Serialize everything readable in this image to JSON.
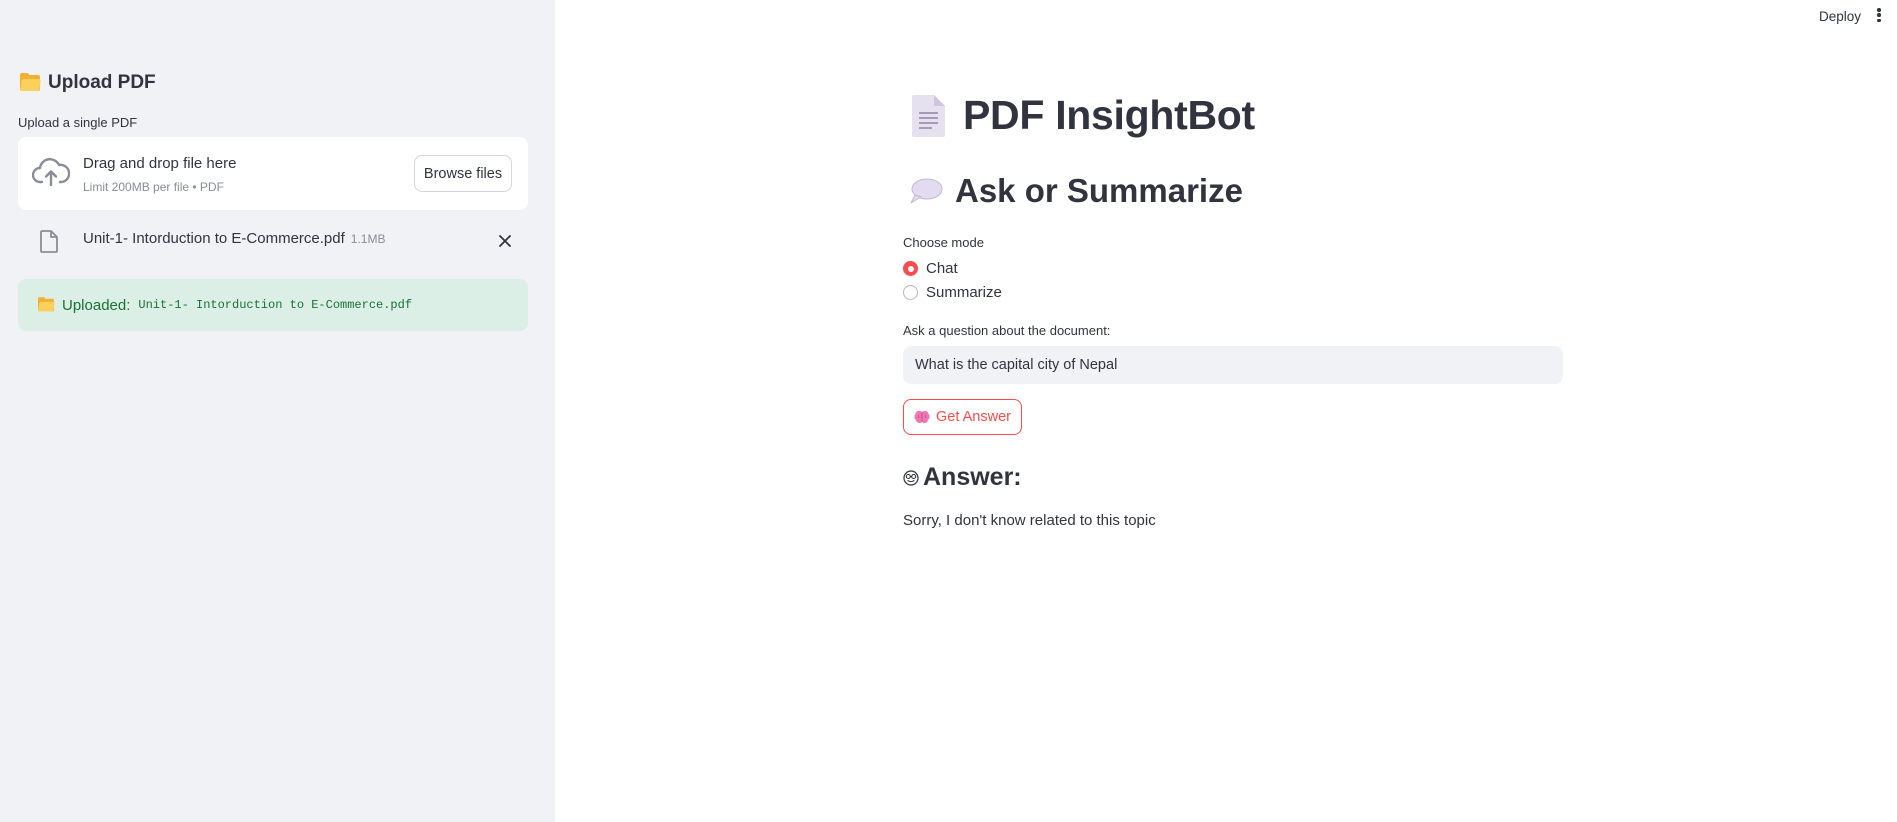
{
  "sidebar": {
    "title": "Upload PDF",
    "upload_label": "Upload a single PDF",
    "dropzone": {
      "main_text": "Drag and drop file here",
      "sub_text": "Limit 200MB per file • PDF",
      "browse_label": "Browse files"
    },
    "file": {
      "name": "Unit-1- Intorduction to E-Commerce.pdf",
      "size": "1.1MB"
    },
    "success": {
      "prefix": "Uploaded:",
      "filename": "Unit-1- Intorduction to E-Commerce.pdf"
    }
  },
  "header": {
    "deploy_label": "Deploy"
  },
  "main": {
    "title": "PDF InsightBot",
    "subtitle": "Ask or Summarize",
    "mode_label": "Choose mode",
    "modes": [
      "Chat",
      "Summarize"
    ],
    "selected_mode": "Chat",
    "question_label": "Ask a question about the document:",
    "question_value": "What is the capital city of Nepal",
    "button_label": "Get Answer",
    "answer_heading": "Answer:",
    "answer_text": "Sorry, I don't know related to this topic"
  },
  "colors": {
    "accent": "#ff4b4b",
    "sidebar_bg": "#f0f2f6",
    "success_bg": "#dcefe6",
    "success_text": "#177233",
    "text": "#31333f"
  },
  "icons": [
    "folder-icon",
    "cloud-upload-icon",
    "file-icon",
    "close-icon",
    "document-icon",
    "speech-bubble-icon",
    "brain-icon",
    "nerd-face-icon",
    "kebab-menu-icon"
  ]
}
